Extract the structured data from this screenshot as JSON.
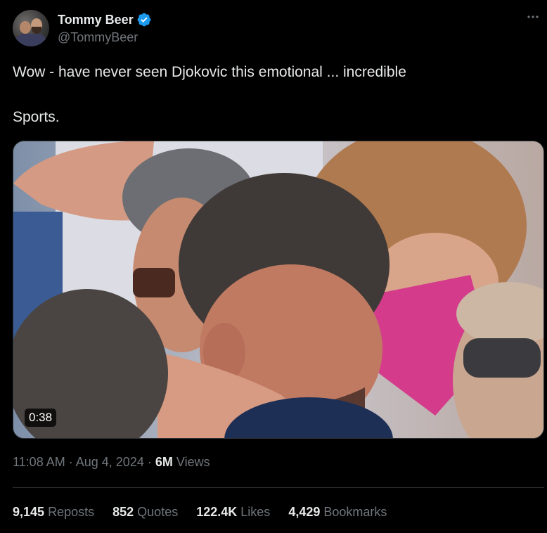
{
  "author": {
    "display_name": "Tommy Beer",
    "handle": "@TommyBeer",
    "verified": true,
    "verified_color": "#1d9bf0"
  },
  "tweet": {
    "text_line1": "Wow - have never seen Djokovic this emotional ... incredible",
    "text_line2": "Sports."
  },
  "media": {
    "type": "video",
    "duration": "0:38"
  },
  "meta": {
    "time": "11:08 AM",
    "separator": "·",
    "date": "Aug 4, 2024",
    "views_count": "6M",
    "views_label": "Views"
  },
  "stats": [
    {
      "value": "9,145",
      "label": "Reposts"
    },
    {
      "value": "852",
      "label": "Quotes"
    },
    {
      "value": "122.4K",
      "label": "Likes"
    },
    {
      "value": "4,429",
      "label": "Bookmarks"
    }
  ],
  "icons": {
    "more": "more-horizontal-icon",
    "verified": "verified-badge-icon"
  },
  "colors": {
    "background": "#000000",
    "text_primary": "#e7e9ea",
    "text_secondary": "#71767b",
    "border": "#2f3336"
  }
}
